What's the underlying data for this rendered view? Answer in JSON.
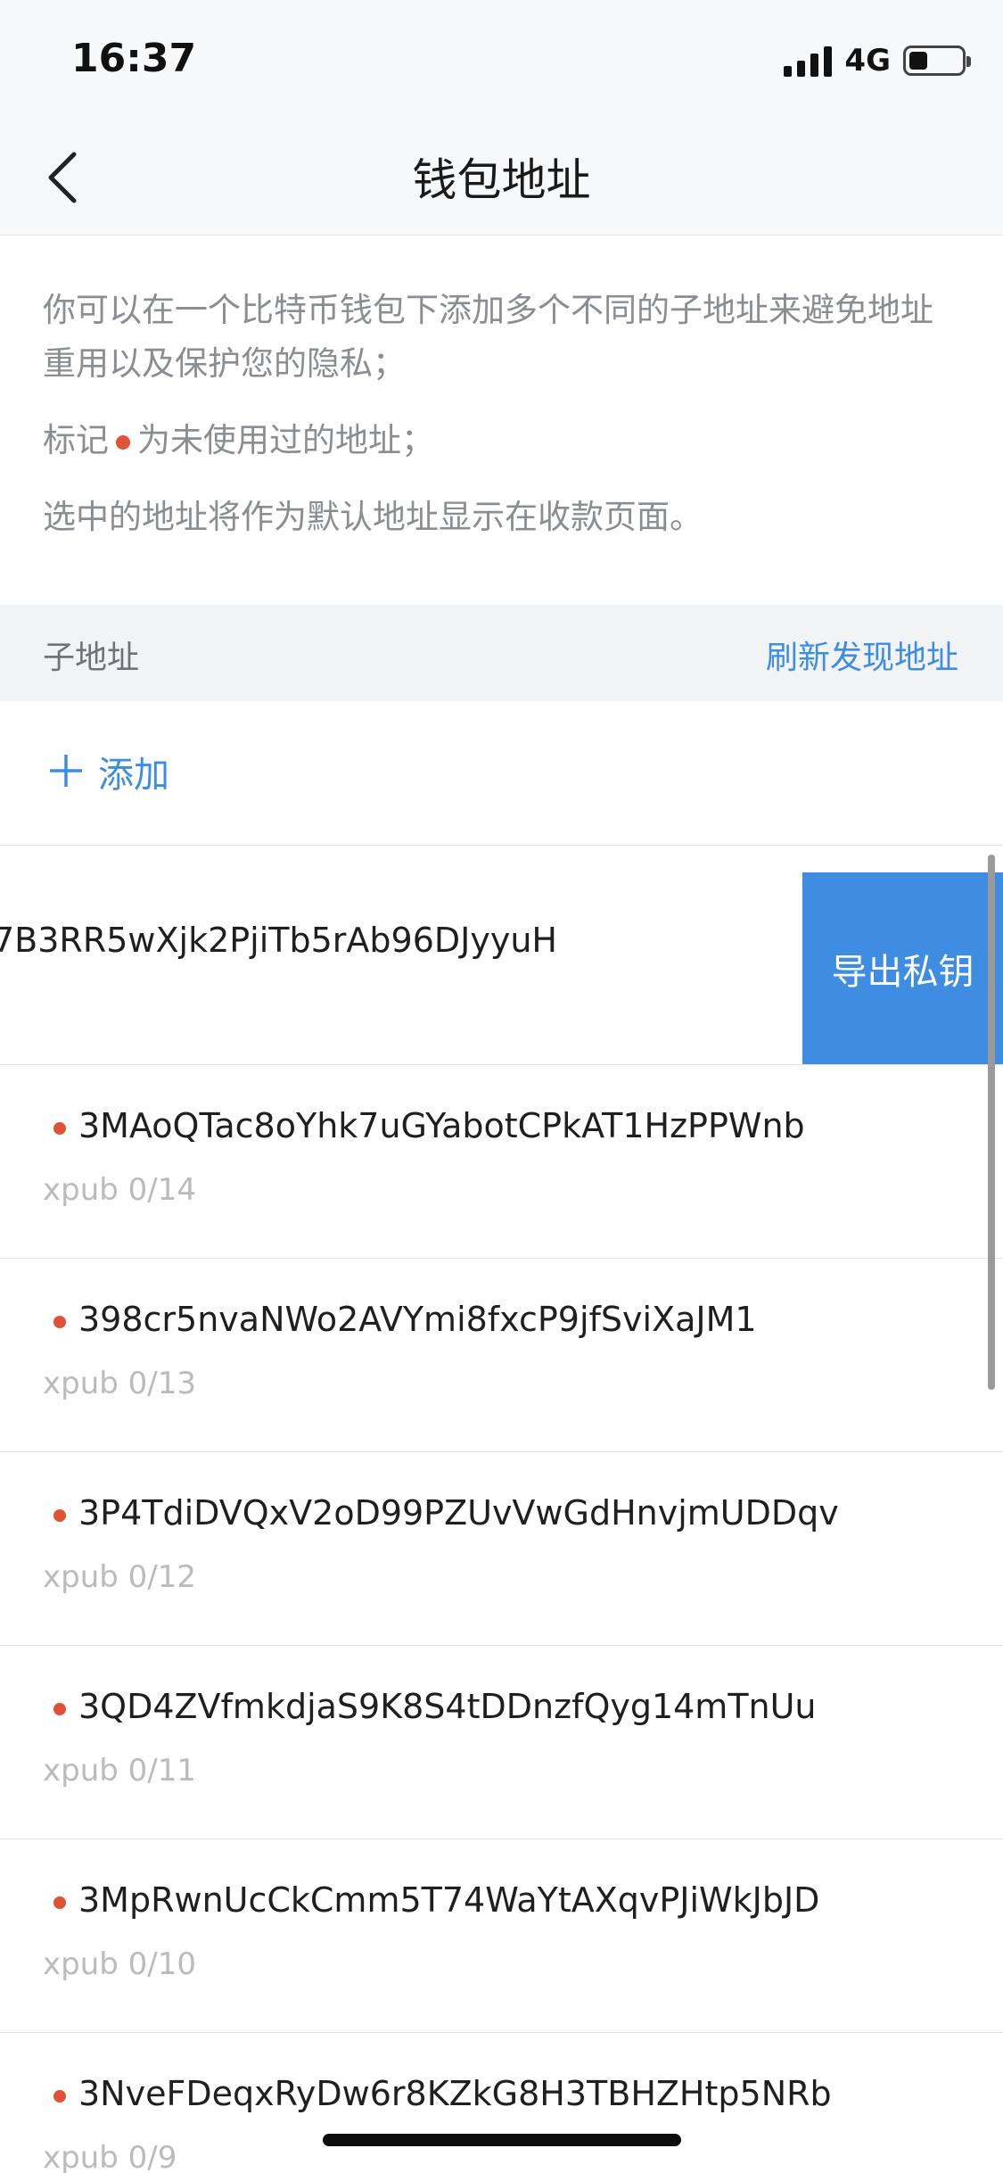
{
  "status_bar": {
    "time": "16:37",
    "network": "4G",
    "battery_level": 0.35
  },
  "nav": {
    "title": "钱包地址",
    "back_icon": "chevron-left-icon"
  },
  "intro": {
    "line1": "你可以在一个比特币钱包下添加多个不同的子地址来避免地址重用以及保护您的隐私；",
    "line2_before": "标记",
    "line2_after": "为未使用过的地址；",
    "line3": "选中的地址将作为默认地址显示在收款页面。"
  },
  "section": {
    "title": "子地址",
    "refresh_label": "刷新发现地址"
  },
  "add": {
    "label": "添加",
    "icon": "plus-icon"
  },
  "swiped_row": {
    "address_visible": "7B3RR5wXjk2PjiTb5rAb96DJyyuH",
    "action_label": "导出私钥"
  },
  "addresses": [
    {
      "address": "3MAoQTac8oYhk7uGYabotCPkAT1HzPPWnb",
      "path": "xpub 0/14"
    },
    {
      "address": "398cr5nvaNWo2AVYmi8fxcP9jfSviXaJM1",
      "path": "xpub 0/13"
    },
    {
      "address": "3P4TdiDVQxV2oD99PZUvVwGdHnvjmUDDqv",
      "path": "xpub 0/12"
    },
    {
      "address": "3QD4ZVfmkdjaS9K8S4tDDnzfQyg14mTnUu",
      "path": "xpub 0/11"
    },
    {
      "address": "3MpRwnUcCkCmm5T74WaYtAXqvPJiWkJbJD",
      "path": "xpub 0/10"
    },
    {
      "address": "3NveFDeqxRyDw6r8KZkG8H3TBHZHtp5NRb",
      "path": "xpub 0/9"
    }
  ],
  "colors": {
    "accent": "#3d8de4",
    "unused_dot": "#e05235",
    "export_bg": "#3f8de2"
  }
}
